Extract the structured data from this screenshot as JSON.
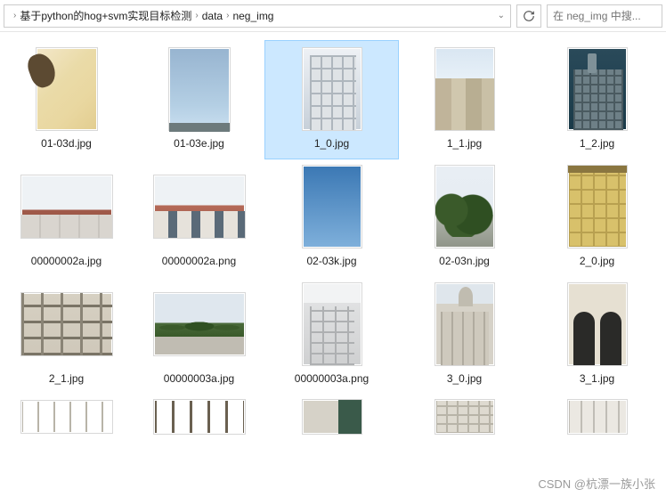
{
  "breadcrumb": {
    "items": [
      "基于python的hog+svm实现目标检测",
      "data",
      "neg_img"
    ]
  },
  "search": {
    "placeholder": "在 neg_img 中搜..."
  },
  "files": [
    {
      "name": "01-03d.jpg",
      "thumb_class": "t-sand",
      "sel": false
    },
    {
      "name": "01-03e.jpg",
      "thumb_class": "t-sky1",
      "sel": false
    },
    {
      "name": "1_0.jpg",
      "thumb_class": "t-bldg-sel",
      "sel": true
    },
    {
      "name": "1_1.jpg",
      "thumb_class": "t-city",
      "sel": false
    },
    {
      "name": "1_2.jpg",
      "thumb_class": "t-euro",
      "sel": false
    },
    {
      "name": "00000002a.jpg",
      "thumb_class": "t-roof1",
      "sel": false
    },
    {
      "name": "00000002a.png",
      "thumb_class": "t-roof2",
      "sel": false
    },
    {
      "name": "02-03k.jpg",
      "thumb_class": "t-sky2",
      "sel": false
    },
    {
      "name": "02-03n.jpg",
      "thumb_class": "t-tree",
      "sel": false
    },
    {
      "name": "2_0.jpg",
      "thumb_class": "t-yellow",
      "sel": false
    },
    {
      "name": "2_1.jpg",
      "thumb_class": "t-balcony",
      "sel": false
    },
    {
      "name": "00000003a.jpg",
      "thumb_class": "t-trees2",
      "sel": false
    },
    {
      "name": "00000003a.png",
      "thumb_class": "t-grey",
      "sel": false
    },
    {
      "name": "3_0.jpg",
      "thumb_class": "t-church",
      "sel": false
    },
    {
      "name": "3_1.jpg",
      "thumb_class": "t-arch",
      "sel": false
    },
    {
      "name": "",
      "thumb_class": "t-partial1",
      "sel": false,
      "partial": true
    },
    {
      "name": "",
      "thumb_class": "t-partial2",
      "sel": false,
      "partial": true
    },
    {
      "name": "",
      "thumb_class": "t-partial3",
      "sel": false,
      "partial": true
    },
    {
      "name": "",
      "thumb_class": "t-partial4",
      "sel": false,
      "partial": true
    },
    {
      "name": "",
      "thumb_class": "t-partial5",
      "sel": false,
      "partial": true
    }
  ],
  "watermark": "CSDN @杭漂一族小张"
}
